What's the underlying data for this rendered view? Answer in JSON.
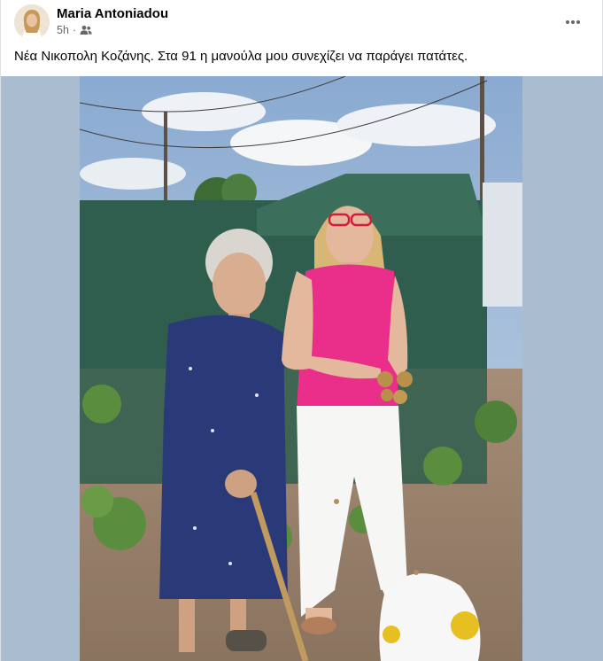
{
  "post": {
    "author": "Maria Antoniadou",
    "time": "5h",
    "separator": "·",
    "audience_icon": "friends-icon",
    "more_icon": "more-horizontal-icon",
    "caption": "Νέα Νικοπολη Κοζάνης. Στα 91 η μανούλα μου συνεχίζει να παράγει πατάτες.",
    "media_bg_color": "#a9bcd0"
  }
}
